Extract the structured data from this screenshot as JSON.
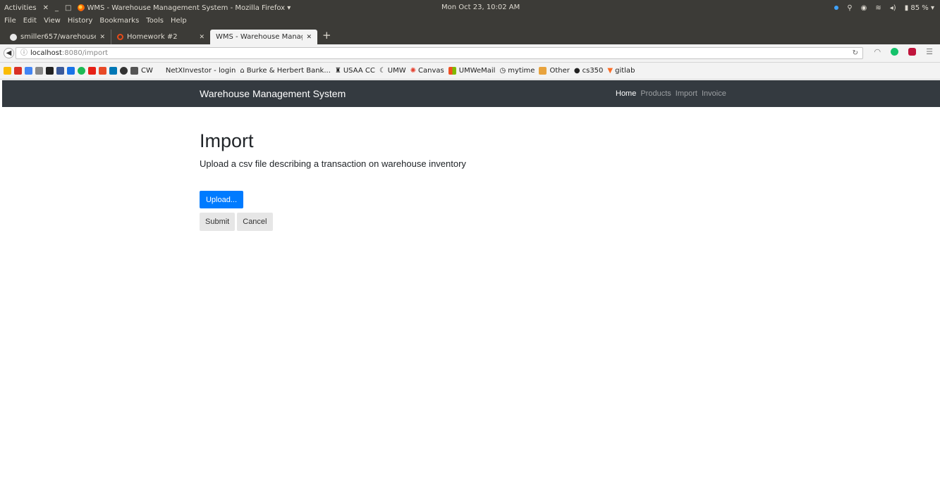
{
  "system_bar": {
    "activities": "Activities",
    "window_title": "WMS - Warehouse Management System - Mozilla Firefox ▾",
    "clock": "Mon Oct 23, 10:02 AM",
    "battery": "85 %"
  },
  "menu": [
    "File",
    "Edit",
    "View",
    "History",
    "Bookmarks",
    "Tools",
    "Help"
  ],
  "tabs": [
    {
      "label": "smiller657/warehouse"
    },
    {
      "label": "Homework #2"
    },
    {
      "label": "WMS - Warehouse Manage"
    }
  ],
  "url": {
    "host": "localhost",
    "path": ":8080/import"
  },
  "bookmarks": [
    {
      "label": "CW"
    },
    {
      "label": "NetXInvestor - login"
    },
    {
      "label": "Burke & Herbert Bank..."
    },
    {
      "label": "USAA CC"
    },
    {
      "label": "UMW"
    },
    {
      "label": "Canvas"
    },
    {
      "label": "UMWeMail"
    },
    {
      "label": "mytime"
    },
    {
      "label": "Other"
    },
    {
      "label": "cs350"
    },
    {
      "label": "gitlab"
    }
  ],
  "site_nav": {
    "brand": "Warehouse Management System",
    "links": [
      {
        "label": "Home",
        "active": true
      },
      {
        "label": "Products",
        "active": false
      },
      {
        "label": "Import",
        "active": false
      },
      {
        "label": "Invoice",
        "active": false
      }
    ]
  },
  "page": {
    "title": "Import",
    "lead": "Upload a csv file describing a transaction on warehouse inventory",
    "upload_label": "Upload...",
    "submit_label": "Submit",
    "cancel_label": "Cancel"
  },
  "colors": {
    "navbar": "#343a40",
    "primary": "#007bff",
    "secondary_btn": "#e6e6e6"
  }
}
